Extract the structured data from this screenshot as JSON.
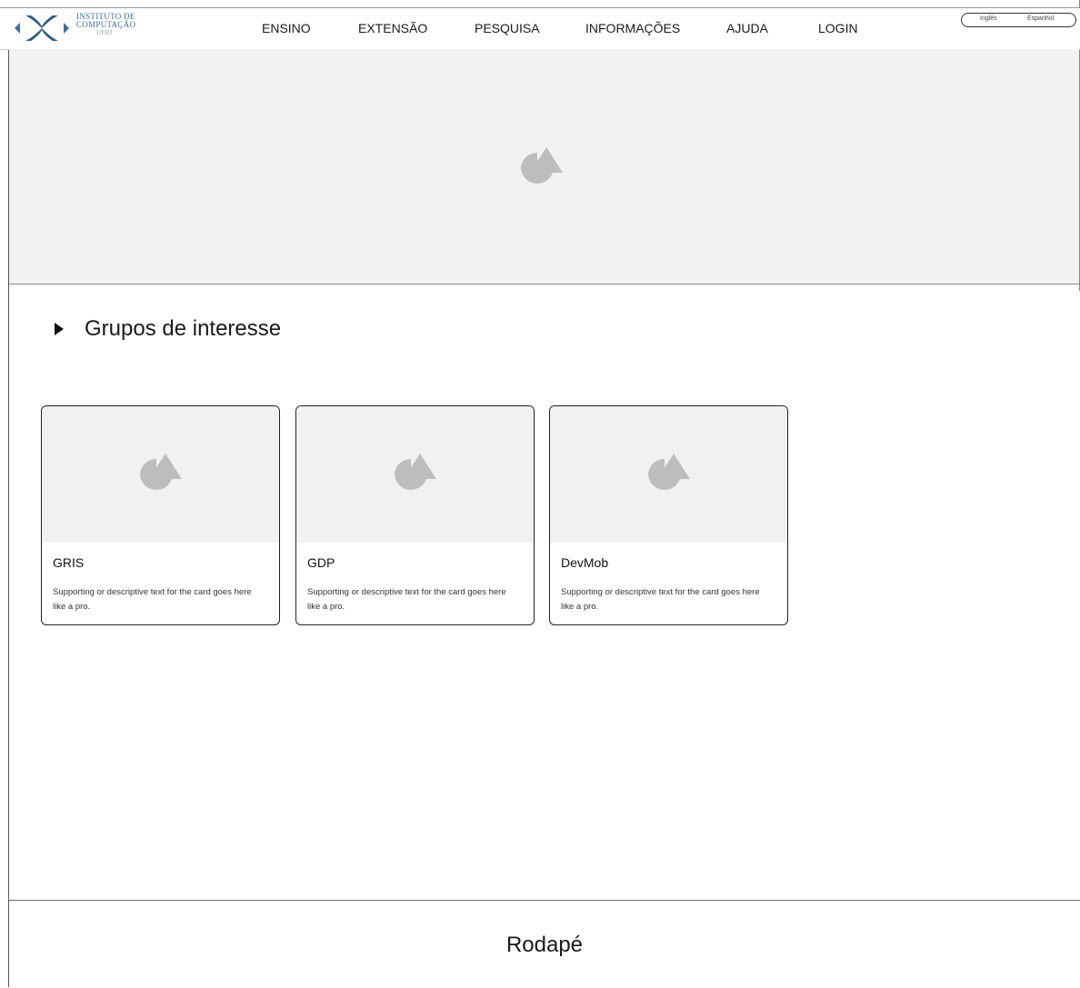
{
  "header": {
    "logo": {
      "line1": "INSTITUTO DE",
      "line2": "COMPUTAÇÃO",
      "line3": "UFRJ",
      "icon": "ic-logo-icon"
    },
    "nav": [
      "ENSINO",
      "EXTENSÃO",
      "PESQUISA",
      "INFORMAÇÕES",
      "AJUDA",
      "LOGIN"
    ],
    "languages": [
      "Inglês",
      "Espanhol"
    ]
  },
  "hero": {
    "icon": "image-placeholder-icon"
  },
  "section": {
    "title": "Grupos de interesse",
    "icon": "triangle-right-icon"
  },
  "cards": [
    {
      "title": "GRIS",
      "text": "Supporting or descriptive text for the card goes here like a pro."
    },
    {
      "title": "GDP",
      "text": "Supporting or descriptive text for the card goes here like a pro."
    },
    {
      "title": "DevMob",
      "text": "Supporting or descriptive text for the card goes here like a pro."
    }
  ],
  "footer": {
    "text": "Rodapé"
  },
  "colors": {
    "logo_blue": "#3f6f9b",
    "placeholder_gray": "#bdbdbd",
    "media_bg": "#f1f1f1"
  }
}
